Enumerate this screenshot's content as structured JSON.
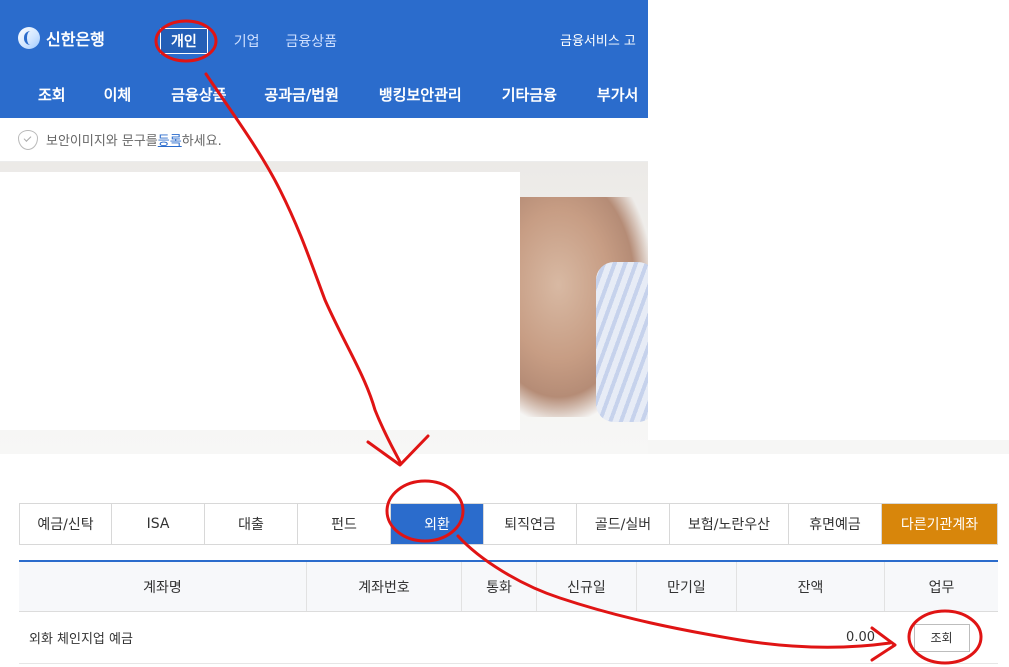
{
  "header": {
    "brand_name": "신한은행",
    "top_nav": [
      {
        "label": "개인",
        "active": true
      },
      {
        "label": "기업",
        "active": false
      },
      {
        "label": "금융상품",
        "active": false
      }
    ],
    "util_text": "금융서비스  고",
    "main_nav": [
      "조회",
      "이체",
      "금융상품",
      "공과금/법원",
      "뱅킹보안관리",
      "기타금융",
      "부가서"
    ]
  },
  "notice": {
    "text_before": "보안이미지와 문구를 ",
    "link": "등록",
    "text_after": "하세요."
  },
  "tabs": [
    {
      "label": "예금/신탁",
      "active": false
    },
    {
      "label": "ISA",
      "active": false
    },
    {
      "label": "대출",
      "active": false
    },
    {
      "label": "펀드",
      "active": false
    },
    {
      "label": "외환",
      "active": true
    },
    {
      "label": "퇴직연금",
      "active": false
    },
    {
      "label": "골드/실버",
      "active": false
    },
    {
      "label": "보험/노란우산",
      "active": false
    },
    {
      "label": "휴면예금",
      "active": false
    },
    {
      "label": "다른기관계좌",
      "active": false,
      "highlight": true
    }
  ],
  "table": {
    "headers": [
      "계좌명",
      "계좌번호",
      "통화",
      "신규일",
      "만기일",
      "잔액",
      "업무"
    ],
    "rows": [
      {
        "name": "외화 체인지업 예금",
        "account": "",
        "currency": "",
        "open_date": "",
        "maturity": "",
        "balance": "0.00",
        "action": "조회"
      }
    ]
  },
  "colors": {
    "brand_blue": "#2b6ccc",
    "other_tab_orange": "#d8860b",
    "annotation_red": "#e01414"
  }
}
